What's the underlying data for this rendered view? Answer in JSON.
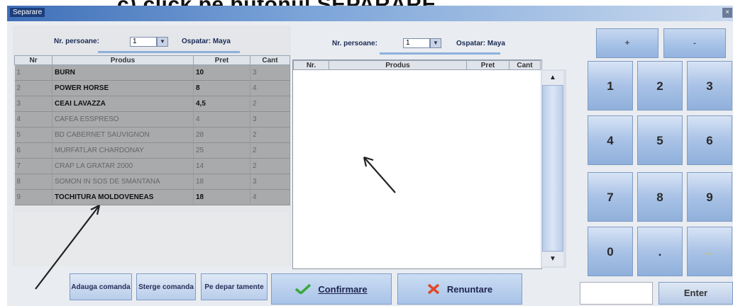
{
  "heading": "c) click pe butonul SEPARARE.",
  "window": {
    "title": "Separare"
  },
  "left": {
    "persons_label": "Nr. persoane:",
    "persons_value": "1",
    "waiter_label": "Ospatar: Maya",
    "columns": [
      "Nr",
      "Produs",
      "Pret",
      "Cant"
    ],
    "rows": [
      {
        "nr": "1",
        "produs": "BURN",
        "pret": "10",
        "cant": "3",
        "bold": true
      },
      {
        "nr": "2",
        "produs": "POWER HORSE",
        "pret": "8",
        "cant": "4",
        "bold": true
      },
      {
        "nr": "3",
        "produs": "CEAI LAVAZZA",
        "pret": "4,5",
        "cant": "2",
        "bold": true
      },
      {
        "nr": "4",
        "produs": "CAFEA ESSPRESO",
        "pret": "4",
        "cant": "3",
        "bold": false
      },
      {
        "nr": "5",
        "produs": "BD CABERNET SAUVIGNON",
        "pret": "28",
        "cant": "2",
        "bold": false
      },
      {
        "nr": "6",
        "produs": "MURFATLAR CHARDONAY",
        "pret": "25",
        "cant": "2",
        "bold": false
      },
      {
        "nr": "7",
        "produs": "CRAP LA GRATAR 2000",
        "pret": "14",
        "cant": "2",
        "bold": false
      },
      {
        "nr": "8",
        "produs": "SOMON IN SOS DE SMANTANA",
        "pret": "18",
        "cant": "3",
        "bold": false
      },
      {
        "nr": "9",
        "produs": "TOCHITURA MOLDOVENEAS",
        "pret": "18",
        "cant": "4",
        "bold": true
      }
    ]
  },
  "right": {
    "persons_label": "Nr. persoane:",
    "persons_value": "1",
    "waiter_label": "Ospatar: Maya",
    "columns": [
      "Nr.",
      "Produs",
      "Pret",
      "Cant"
    ]
  },
  "keypad": {
    "plus": "+",
    "minus": "-",
    "keys": [
      "1",
      "2",
      "3",
      "4",
      "5",
      "6",
      "7",
      "8",
      "9",
      "0",
      ".",
      "←"
    ],
    "enter": "Enter"
  },
  "buttons": {
    "adauga": "Adauga comanda",
    "sterge": "Sterge comanda",
    "pe_departamente": "Pe depar tamente",
    "confirmare": "Confirmare",
    "renuntare": "Renuntare"
  },
  "colors": {
    "button_blue": "#a9c2e6",
    "grid_gray": "#a9aaab",
    "arrow": "#222222"
  }
}
